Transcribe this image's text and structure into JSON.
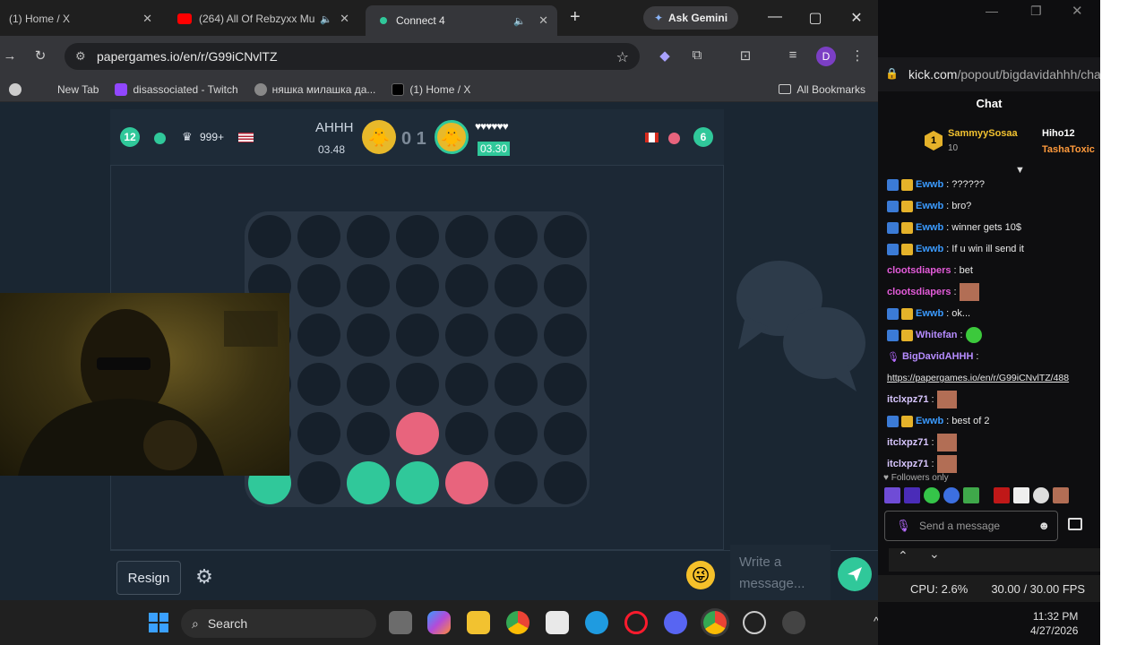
{
  "browser": {
    "tabs": [
      {
        "label": "(1) Home / X"
      },
      {
        "label": "(264) All Of Rebzyxx Mu"
      },
      {
        "label": "Connect 4"
      }
    ],
    "ask_gemini": "Ask Gemini",
    "url": "papergames.io/en/r/G99iCNvlTZ",
    "profile_initial": "D",
    "bookmarks": [
      {
        "label": "New Tab"
      },
      {
        "label": "disassociated - Twitch"
      },
      {
        "label": "няшка милашка да..."
      },
      {
        "label": "(1) Home / X"
      }
    ],
    "all_bookmarks": "All Bookmarks"
  },
  "game": {
    "left_player": {
      "level": "12",
      "rank": "999+",
      "name": "AHHH",
      "time": "03.48"
    },
    "score": "0 1",
    "right_player": {
      "hearts": "♥♥♥♥♥♥",
      "time": "03.30",
      "level": "6"
    },
    "resign_label": "Resign",
    "message_placeholder": "Write a message...",
    "board": {
      "rows": 6,
      "cols": 7,
      "pieces": [
        {
          "row": 5,
          "col": 0,
          "color": "teal"
        },
        {
          "row": 5,
          "col": 2,
          "color": "teal"
        },
        {
          "row": 5,
          "col": 3,
          "color": "teal"
        },
        {
          "row": 5,
          "col": 4,
          "color": "pink"
        },
        {
          "row": 4,
          "col": 3,
          "color": "pink"
        }
      ]
    }
  },
  "taskbar": {
    "search_label": "Search",
    "time": "11:32 PM",
    "date": "4/27/2026"
  },
  "kick": {
    "url_host": "kick.com",
    "url_path": "/popout/bigdavidahhh/cha",
    "chat_title": "Chat",
    "pinned_user": "SammyySosaa",
    "pinned_count": "10",
    "top_users": [
      "Hiho12",
      "TashaToxic"
    ],
    "messages": [
      {
        "user": "Ewwb",
        "color": "#3b9bff",
        "text": ": ??????",
        "badges": true
      },
      {
        "user": "Ewwb",
        "color": "#3b9bff",
        "text": ": bro?",
        "badges": true
      },
      {
        "user": "Ewwb",
        "color": "#3b9bff",
        "text": ": winner gets 10$",
        "badges": true
      },
      {
        "user": "Ewwb",
        "color": "#3b9bff",
        "text": ": If u win ill send it",
        "badges": true
      },
      {
        "user": "clootsdiapers",
        "color": "#e35bd9",
        "text": ": bet",
        "badges": false
      },
      {
        "user": "clootsdiapers",
        "color": "#e35bd9",
        "text": ":",
        "badges": false,
        "face": true
      },
      {
        "user": "Ewwb",
        "color": "#3b9bff",
        "text": ": ok...",
        "badges": true
      },
      {
        "user": "Whitefan",
        "color": "#b68cff",
        "text": ":",
        "badges": true
      },
      {
        "user": "BigDavidAHHH",
        "color": "#b68cff",
        "text": ":",
        "badges": false
      },
      {
        "user": "",
        "color": "#e8e8e8",
        "text": "https://papergames.io/en/r/G99iCNvlTZ/488",
        "badges": false
      },
      {
        "user": "itclxpz71",
        "color": "#d8c6ff",
        "text": ":",
        "badges": false,
        "face": true
      },
      {
        "user": "Ewwb",
        "color": "#3b9bff",
        "text": ": best of 2",
        "badges": true
      },
      {
        "user": "itclxpz71",
        "color": "#d8c6ff",
        "text": ":",
        "badges": false,
        "face": true
      },
      {
        "user": "itclxpz71",
        "color": "#d8c6ff",
        "text": ":",
        "badges": false,
        "face": true
      }
    ],
    "followers_only": "Followers only",
    "send_placeholder": "Send a message"
  },
  "obs": {
    "cpu": "CPU: 2.6%",
    "fps": "30.00 / 30.00 FPS"
  },
  "colors": {
    "teal": "#30c89a",
    "pink": "#e8647d",
    "board": "#2a3644"
  }
}
